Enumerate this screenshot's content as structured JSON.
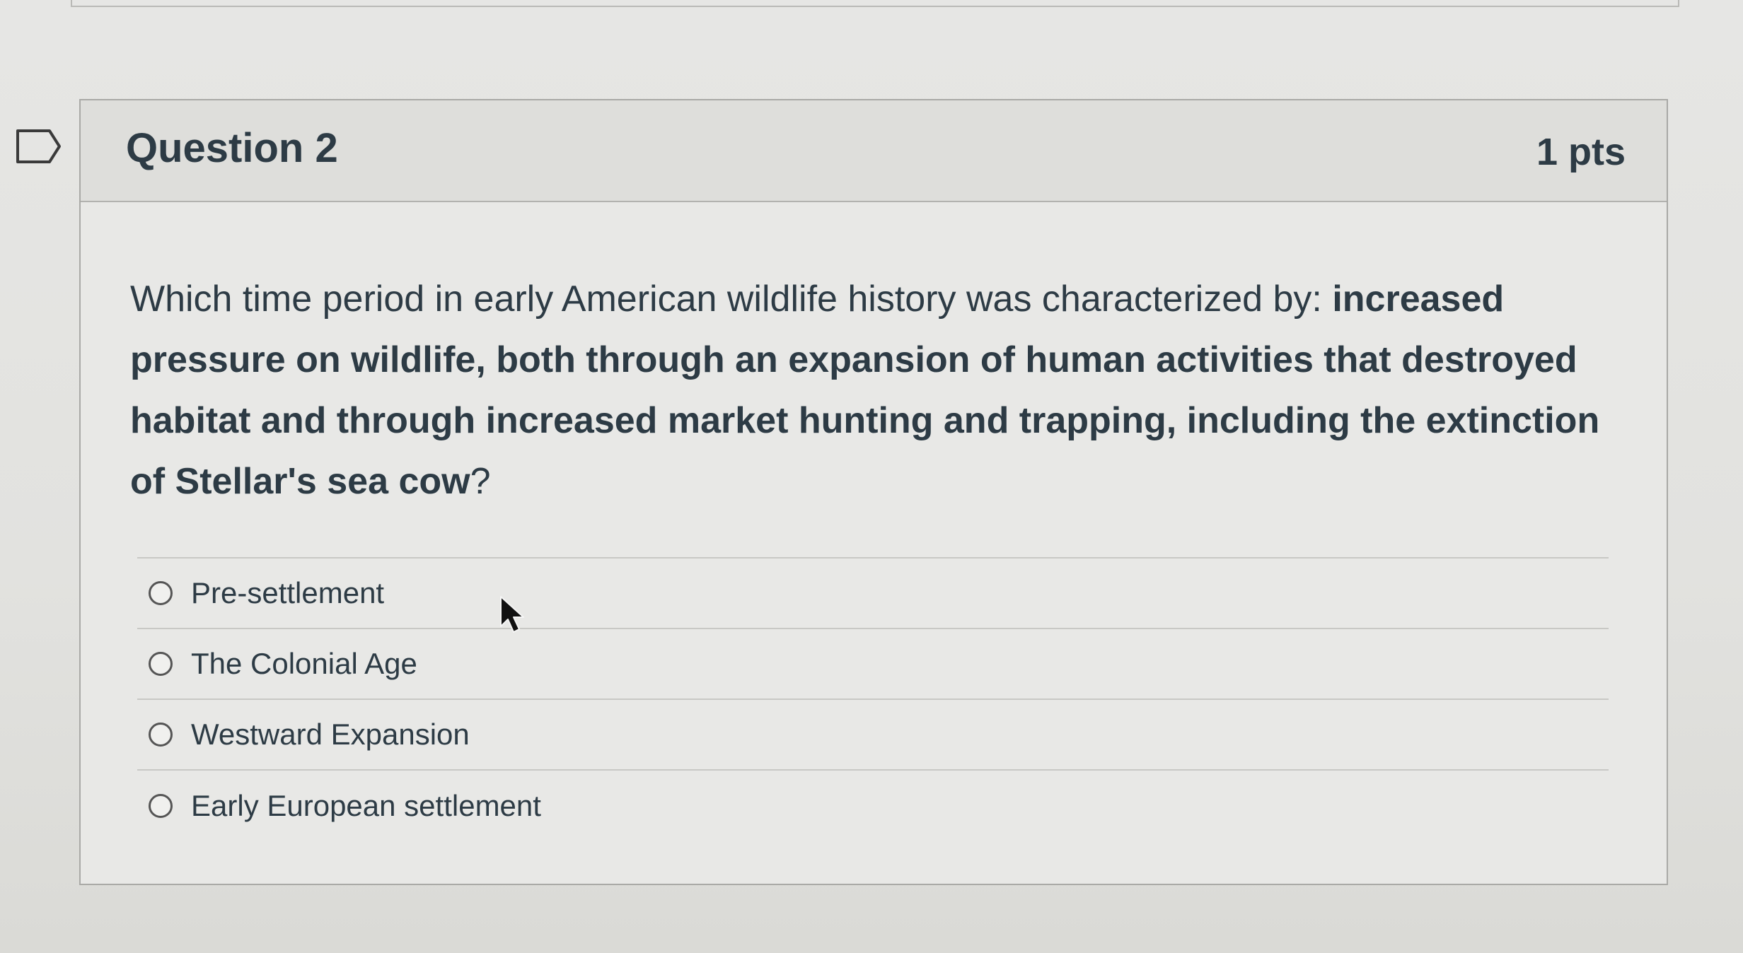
{
  "question": {
    "title": "Question 2",
    "points": "1 pts",
    "text_plain": "Which time period in early American wildlife history was characterized by: ",
    "text_bold": "increased pressure on wildlife, both through an expansion of human activities that destroyed habitat and through increased market hunting and trapping, including the extinction of Stellar's sea cow",
    "text_end": "?"
  },
  "answers": [
    {
      "label": "Pre-settlement",
      "selected": false
    },
    {
      "label": "The Colonial Age",
      "selected": false
    },
    {
      "label": "Westward Expansion",
      "selected": false
    },
    {
      "label": "Early European settlement",
      "selected": false
    }
  ],
  "icons": {
    "flag": "bookmark-flag-icon",
    "radio": "radio-button-icon",
    "cursor": "mouse-pointer-icon"
  },
  "colors": {
    "text": "#2d3b45",
    "header_bg": "#dededb",
    "card_border": "#a9a9a6"
  }
}
